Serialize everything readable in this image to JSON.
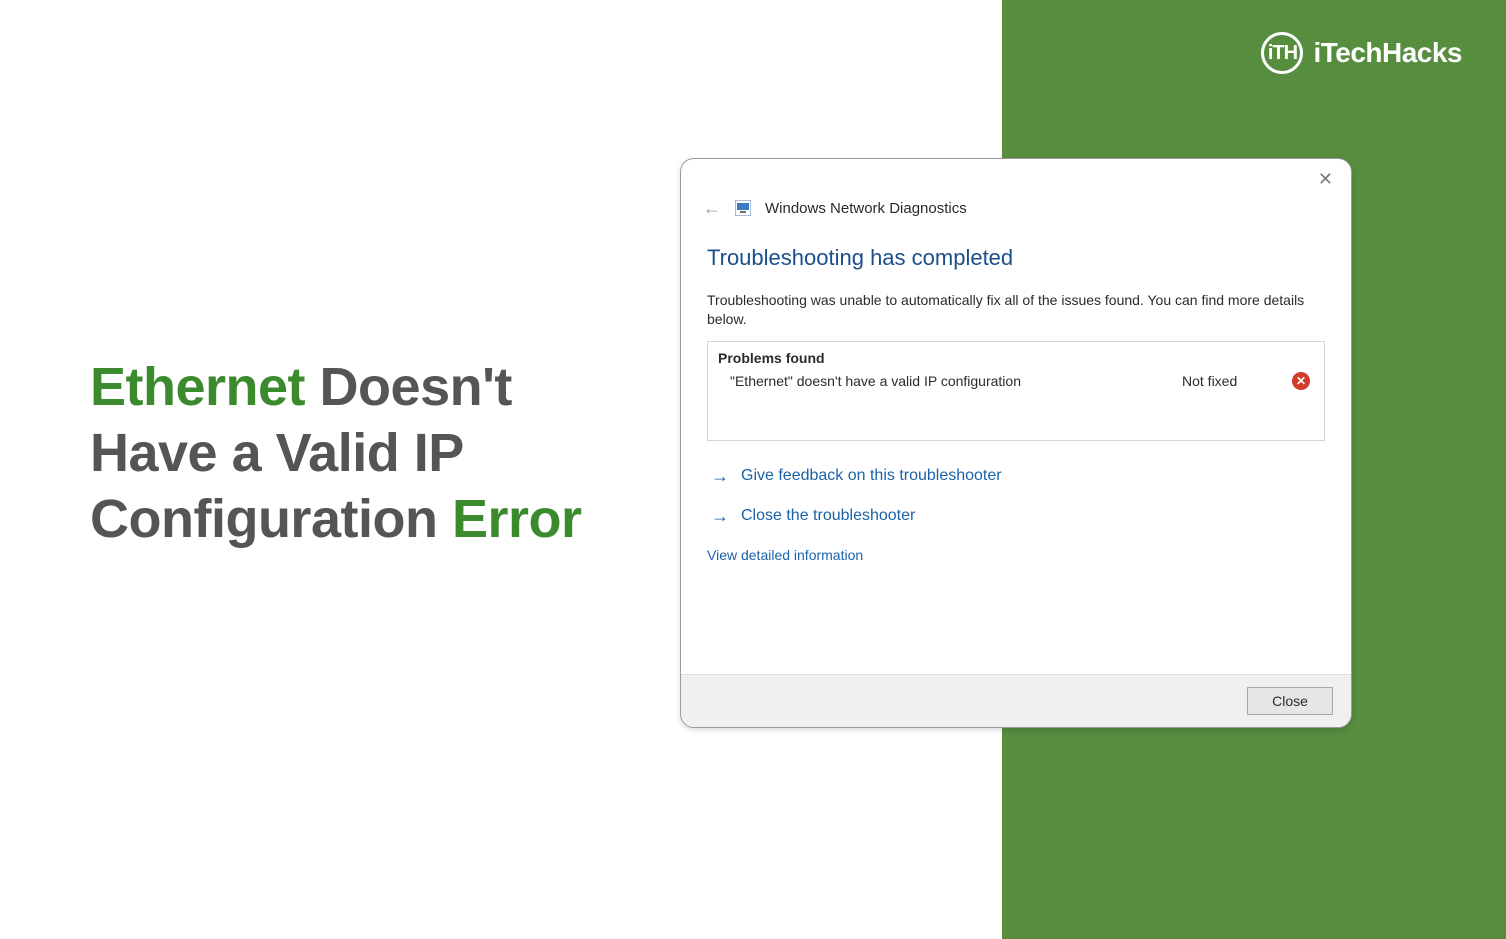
{
  "brand": {
    "badge": "iTH",
    "name": "iTechHacks"
  },
  "headline": {
    "w1": "Ethernet",
    "w2": " Doesn't Have a Valid IP Configuration ",
    "w3": "Error"
  },
  "dialog": {
    "title": "Windows Network Diagnostics",
    "close_x": "✕",
    "heading": "Troubleshooting has completed",
    "subtext": "Troubleshooting was unable to automatically fix all of the issues found. You can find more details below.",
    "problems_title": "Problems found",
    "problem": {
      "text": "\"Ethernet\" doesn't have a valid IP configuration",
      "status": "Not fixed",
      "err_glyph": "✕"
    },
    "actions": {
      "feedback": "Give feedback on this troubleshooter",
      "close_ts": "Close the troubleshooter",
      "arrow": "→"
    },
    "detail_link": "View detailed information",
    "close_button": "Close",
    "back_arrow": "←"
  },
  "colors": {
    "accent_green": "#568d3f",
    "text_green": "#3b8b2e",
    "link_blue": "#1a63a8",
    "heading_blue": "#1a4f8b",
    "error_red": "#d23a2a"
  }
}
